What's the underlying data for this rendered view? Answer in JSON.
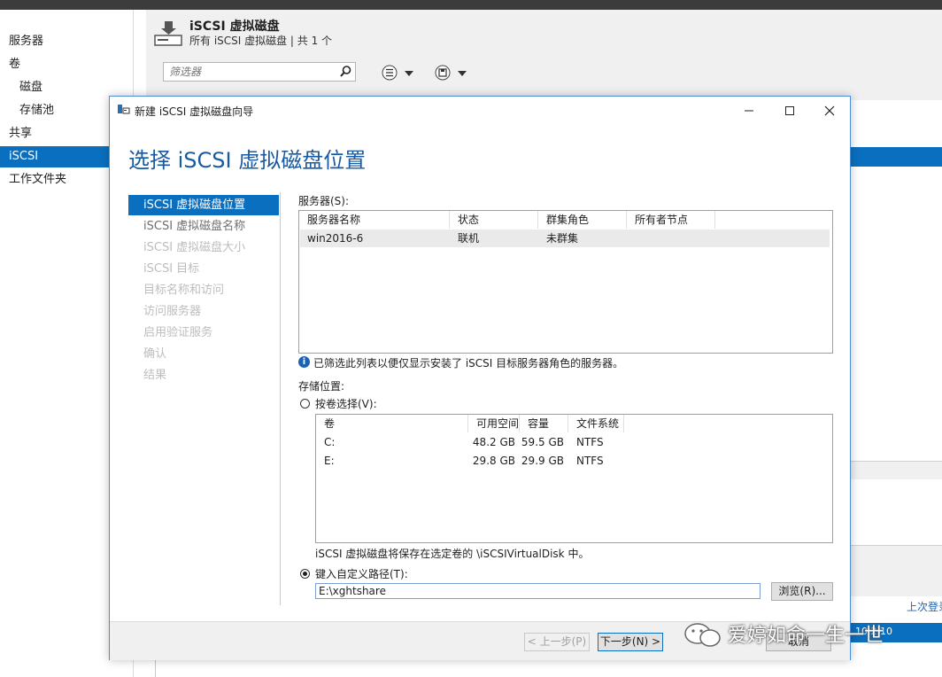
{
  "nav": {
    "items": [
      {
        "label": "服务器",
        "level": "top"
      },
      {
        "label": "卷",
        "level": "top"
      },
      {
        "label": "磁盘",
        "level": "sub"
      },
      {
        "label": "存储池",
        "level": "sub"
      },
      {
        "label": "共享",
        "level": "top"
      },
      {
        "label": "iSCSI",
        "level": "top",
        "selected": true
      },
      {
        "label": "工作文件夹",
        "level": "top"
      }
    ]
  },
  "header": {
    "title": "iSCSI 虚拟磁盘",
    "subtitle": "所有 iSCSI 虚拟磁盘 | 共 1 个",
    "filter_placeholder": "筛选器"
  },
  "background": {
    "last_refresh": "上次登录",
    "ip_fragment": "10.2.10"
  },
  "dialog": {
    "title": "新建 iSCSI 虚拟磁盘向导",
    "heading": "选择 iSCSI 虚拟磁盘位置",
    "steps": [
      {
        "label": "iSCSI 虚拟磁盘位置",
        "state": "active"
      },
      {
        "label": "iSCSI 虚拟磁盘名称",
        "state": "enabled"
      },
      {
        "label": "iSCSI 虚拟磁盘大小",
        "state": "disabled"
      },
      {
        "label": "iSCSI 目标",
        "state": "disabled"
      },
      {
        "label": "目标名称和访问",
        "state": "disabled"
      },
      {
        "label": "访问服务器",
        "state": "disabled"
      },
      {
        "label": "启用验证服务",
        "state": "disabled"
      },
      {
        "label": "确认",
        "state": "disabled"
      },
      {
        "label": "结果",
        "state": "disabled"
      }
    ],
    "servers": {
      "label": "服务器(S):",
      "columns": [
        "服务器名称",
        "状态",
        "群集角色",
        "所有者节点"
      ],
      "rows": [
        [
          "win2016-6",
          "联机",
          "未群集",
          ""
        ]
      ]
    },
    "info_text": "已筛选此列表以便仅显示安装了 iSCSI 目标服务器角色的服务器。",
    "storage_label": "存储位置:",
    "by_volume_label": "按卷选择(V):",
    "volumes": {
      "columns": [
        "卷",
        "可用空间",
        "容量",
        "文件系统"
      ],
      "rows": [
        [
          "C:",
          "48.2 GB",
          "59.5 GB",
          "NTFS"
        ],
        [
          "E:",
          "29.8 GB",
          "29.9 GB",
          "NTFS"
        ]
      ]
    },
    "volume_note": "iSCSI 虚拟磁盘将保存在选定卷的 \\iSCSIVirtualDisk 中。",
    "custom_path_label": "键入自定义路径(T):",
    "custom_path_value": "E:\\xghtshare",
    "browse_label": "浏览(R)...",
    "buttons": {
      "prev": "< 上一步(P)",
      "next": "下一步(N) >",
      "cancel": "取消"
    }
  },
  "watermark": {
    "text": "爱婷如命一生一世"
  },
  "colors": {
    "accent": "#0a6fbf",
    "heading": "#1a5aa0",
    "info": "#1a64b5"
  }
}
